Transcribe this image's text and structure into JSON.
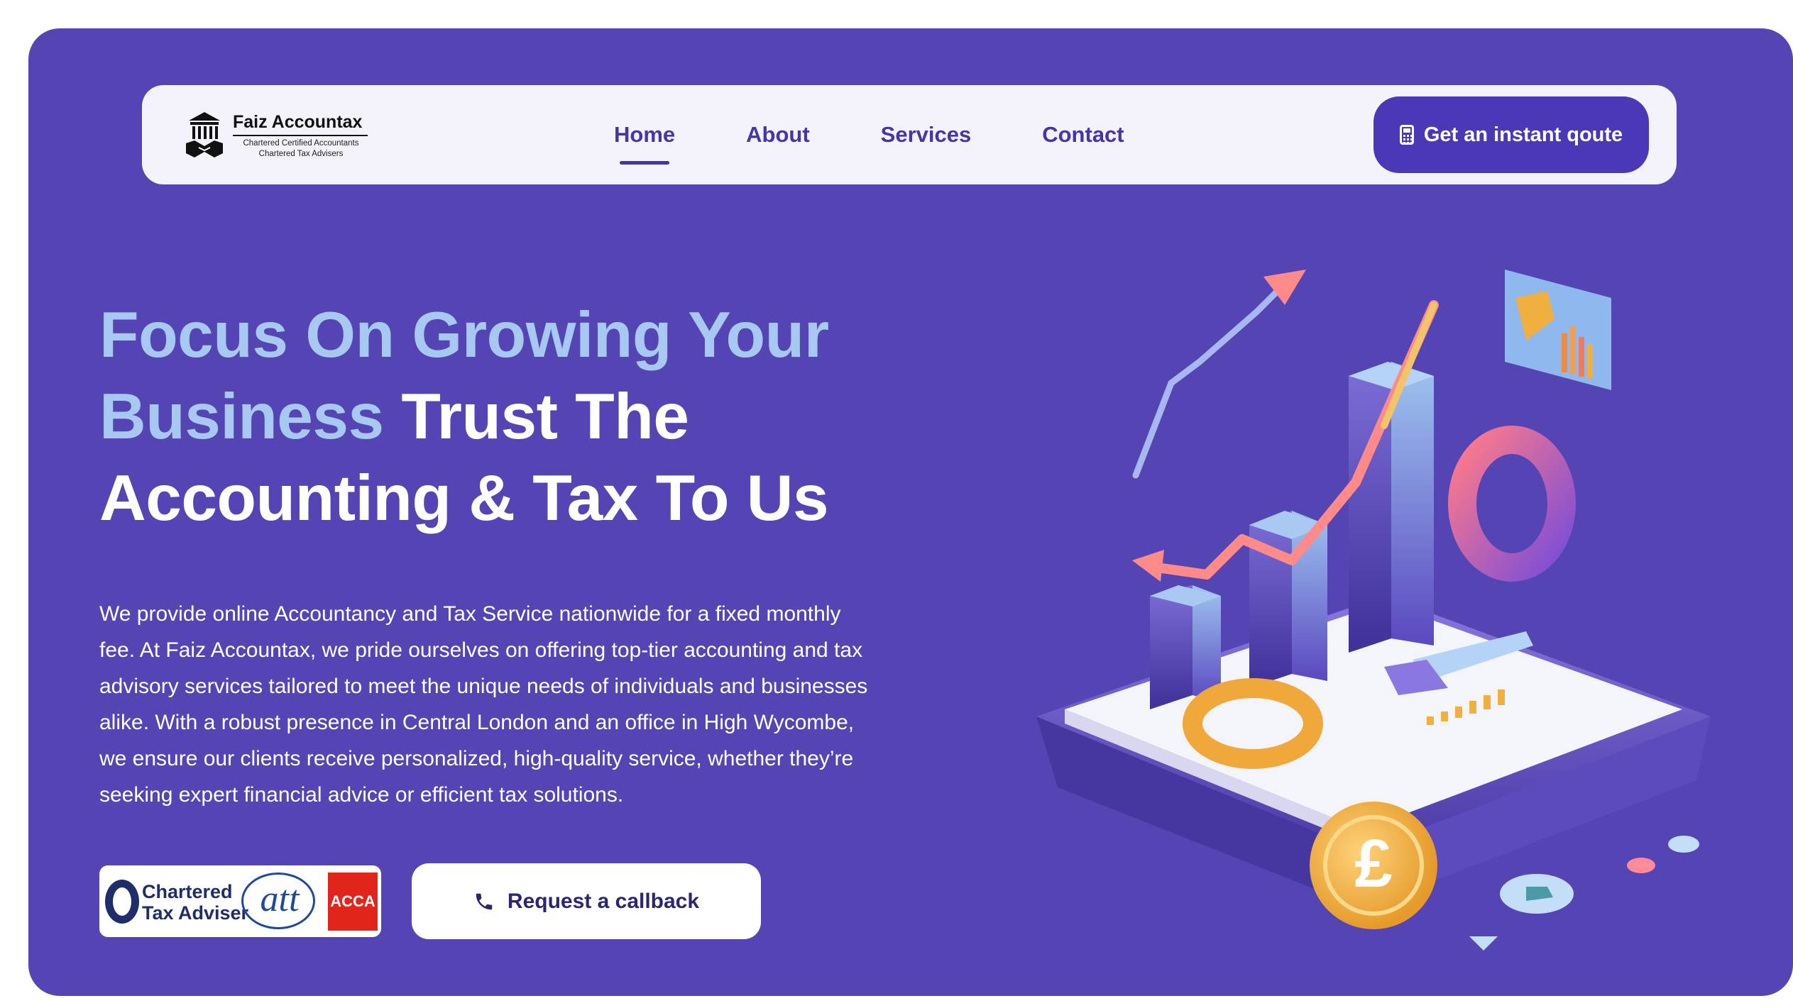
{
  "brand": {
    "name": "Faiz Accountax",
    "tagline_1": "Chartered Certified Accountants",
    "tagline_2": "Chartered Tax Advisers"
  },
  "nav": {
    "items": [
      {
        "label": "Home",
        "active": true
      },
      {
        "label": "About",
        "active": false
      },
      {
        "label": "Services",
        "active": false
      },
      {
        "label": "Contact",
        "active": false
      }
    ],
    "cta": {
      "label": "Get an instant qoute",
      "icon": "calculator-icon"
    }
  },
  "hero": {
    "headline_light": "Focus On Growing Your Business",
    "headline_white": "Trust The Accounting & Tax To Us",
    "description": "We provide online Accountancy and Tax Service nationwide for a fixed monthly fee. At Faiz Accountax, we pride ourselves on offering top-tier accounting and tax advisory services tailored to meet the unique needs of individuals and businesses alike. With a robust presence in Central London and an office in High Wycombe, we ensure our clients receive personalized, high-quality service, whether they’re seeking expert financial advice or efficient tax solutions.",
    "callback": {
      "label": "Request a callback",
      "icon": "phone-icon"
    }
  },
  "badges": {
    "chartered_line_1": "Chartered",
    "chartered_line_2": "Tax Adviser",
    "att": "att",
    "acca": "ACCA"
  },
  "colors": {
    "background": "#5545b4",
    "nav_background": "#f4f2fa",
    "primary_button": "#4a38b6",
    "headline_accent": "#a7c8f0",
    "nav_text": "#4536a8"
  }
}
